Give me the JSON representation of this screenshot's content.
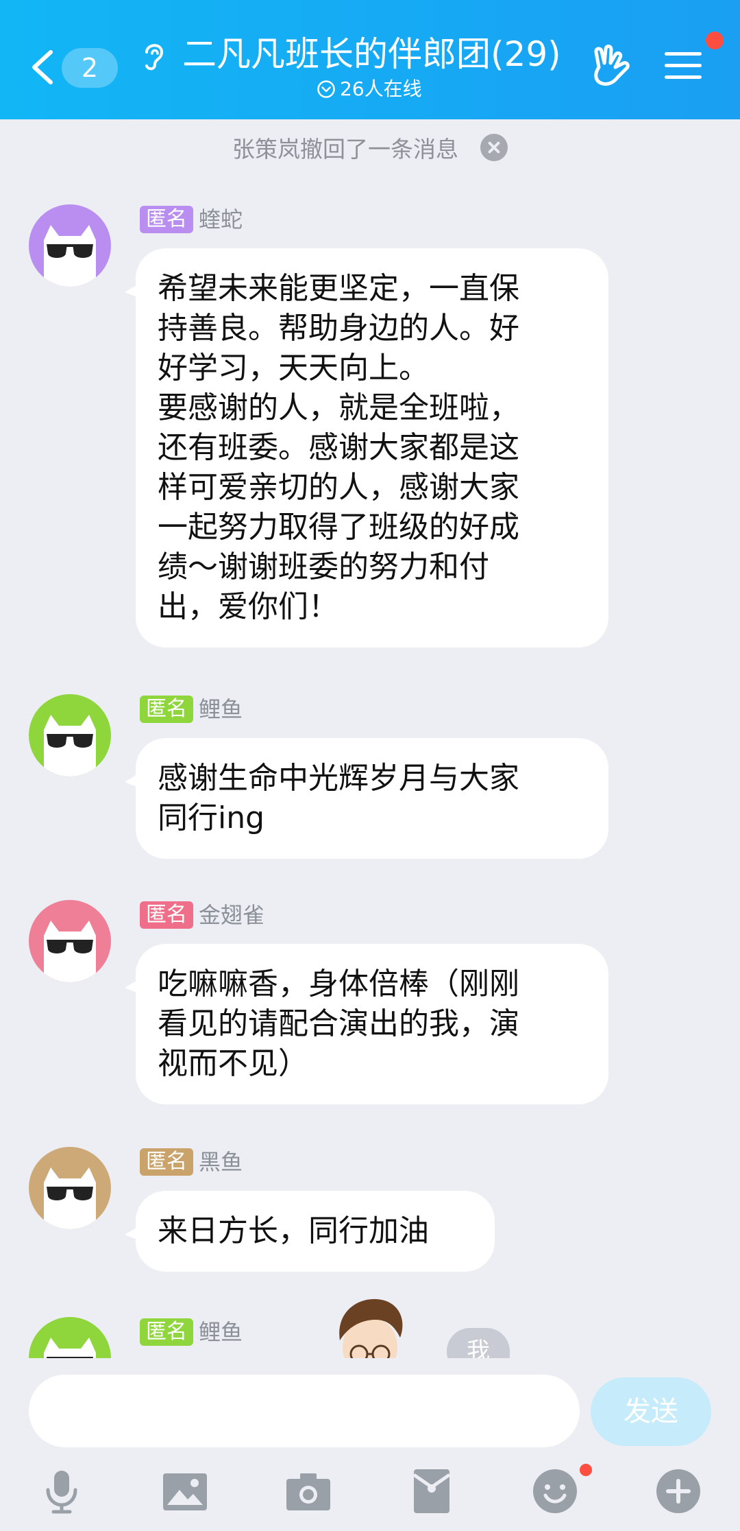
{
  "header": {
    "back_count": "2",
    "title": "二凡凡班长的伴郎团(29)",
    "online": "26人在线",
    "colors": {
      "bar_start": "#12b6f5",
      "bar_end": "#1a9ff3",
      "notify_dot": "#ff4d3f"
    }
  },
  "notice": {
    "recall_text": "张策岚撤回了一条消息"
  },
  "messages": [
    {
      "tag": "匿名",
      "name": "蝰蛇",
      "tag_color": "#b98ef0",
      "avatar_color": "#b98ef0",
      "text": "希望未来能更坚定，一直保\n持善良。帮助身边的人。好\n好学习，天天向上。\n要感谢的人，就是全班啦，\n还有班委。感谢大家都是这\n样可爱亲切的人，感谢大家\n一起努力取得了班级的好成\n绩～谢谢班委的努力和付\n出，爱你们！"
    },
    {
      "tag": "匿名",
      "name": "鲤鱼",
      "tag_color": "#8fd63c",
      "avatar_color": "#8fd63c",
      "text": "感谢生命中光辉岁月与大家\n同行ing"
    },
    {
      "tag": "匿名",
      "name": "金翅雀",
      "tag_color": "#ef6f8a",
      "avatar_color": "#ef7f96",
      "text": "吃嘛嘛香，身体倍棒（刚刚\n看见的请配合演出的我，演\n视而不见）"
    },
    {
      "tag": "匿名",
      "name": "黑鱼",
      "tag_color": "#c9a36a",
      "avatar_color": "#cda977",
      "text": "来日方长，同行加油"
    },
    {
      "tag": "匿名",
      "name": "鲤鱼",
      "tag_color": "#8fd63c",
      "avatar_color": "#8fd63c",
      "text": ""
    }
  ],
  "self_badge": "我",
  "input": {
    "value": "",
    "send_label": "发送"
  },
  "toolbar": [
    "mic-icon",
    "image-icon",
    "camera-icon",
    "red-packet-icon",
    "emoji-icon",
    "plus-icon"
  ]
}
